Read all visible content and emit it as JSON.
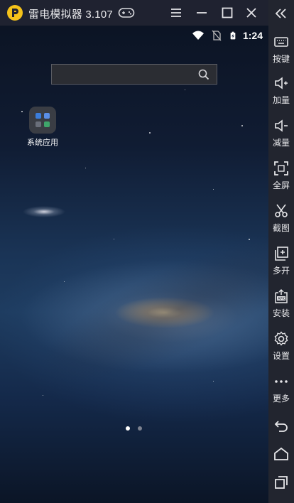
{
  "titlebar": {
    "app_name": "雷电模拟器 3.107"
  },
  "statusbar": {
    "time": "1:24"
  },
  "search": {
    "value": "",
    "placeholder": ""
  },
  "desktop": {
    "folder_label": "系统应用",
    "page_count": 2,
    "current_page": 1
  },
  "toolbar": {
    "keys": "按键",
    "volume_up": "加量",
    "volume_down": "减量",
    "fullscreen": "全屏",
    "screenshot": "截图",
    "multi_open": "多开",
    "install": "安装",
    "settings": "设置",
    "more": "更多"
  },
  "colors": {
    "title_bg": "#1f2230",
    "sidebar_bg": "#22252f",
    "logo": "#f4c21a"
  }
}
